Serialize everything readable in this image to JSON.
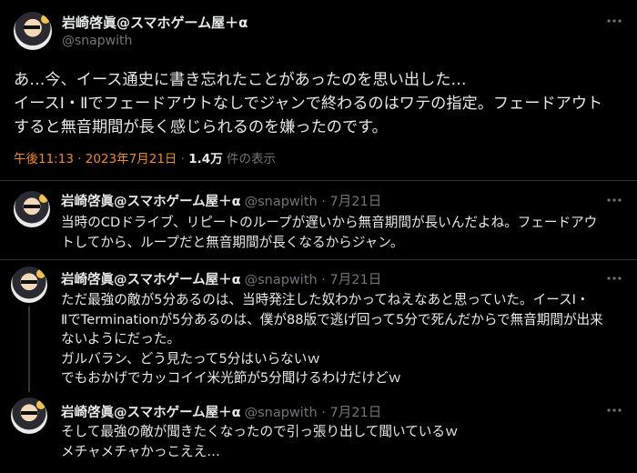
{
  "main_tweet": {
    "display_name": "岩崎啓眞@スマホゲーム屋＋α",
    "handle": "@snapwith",
    "lines": [
      "あ…今、イース通史に書き忘れたことがあったのを思い出した…",
      "イースⅠ・Ⅱでフェードアウトなしでジャンで終わるのはワテの指定。フェードアウト",
      "すると無音期間が長く感じられるのを嫌ったのです。"
    ],
    "time": "午後11:13 · 2023年7月21日",
    "separator": " · ",
    "views_count": "1.4万",
    "views_label": " 件の表示"
  },
  "replies": [
    {
      "display_name": "岩崎啓眞@スマホゲーム屋＋α",
      "meta": "@snapwith · 7月21日",
      "lines": [
        "当時のCDドライブ、リピートのループが遅いから無音期間が長いんだよね。フェードアウ",
        "トしてから、ループだと無音期間が長くなるからジャン。"
      ]
    },
    {
      "display_name": "岩崎啓眞@スマホゲーム屋＋α",
      "meta": "@snapwith · 7月21日",
      "lines": [
        "ただ最強の敵が5分あるのは、当時発注した奴わかってねえなあと思っていた。イースⅠ・",
        "ⅡでTerminationが5分あるのは、僕が88版で逃げ回って5分で死んだからで無音期間が出来",
        "ないようにだった。",
        "ガルバラン、どう見たって5分はいらないｗ",
        "でもおかげでカッコイイ米光節が5分聞けるわけだけどｗ"
      ]
    },
    {
      "display_name": "岩崎啓眞@スマホゲーム屋＋α",
      "meta": "@snapwith · 7月21日",
      "lines": [
        "そして最強の敵が聞きたくなったので引っ張り出して聞いているｗ",
        "メチャメチャかっこええ…"
      ]
    }
  ]
}
